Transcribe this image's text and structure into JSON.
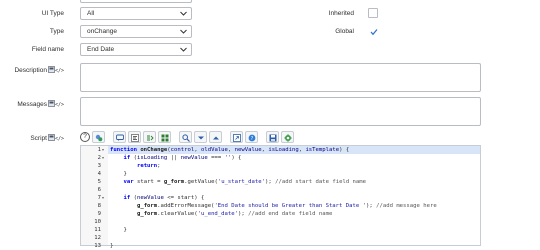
{
  "form": {
    "ui_type": {
      "label": "UI Type",
      "value": "All"
    },
    "type": {
      "label": "Type",
      "value": "onChange"
    },
    "field_name": {
      "label": "Field name",
      "value": "End Date"
    },
    "inherited": {
      "label": "Inherited",
      "checked": false
    },
    "global": {
      "label": "Global",
      "checked": true
    },
    "description": {
      "label": "Description",
      "tag": "</>",
      "value": ""
    },
    "messages": {
      "label": "Messages",
      "tag": "</>",
      "value": ""
    },
    "script": {
      "label": "Script",
      "tag": "</>"
    }
  },
  "toolbar": {
    "help": "?",
    "buttons": [
      "toggle-syntax-icon",
      "comment-icon",
      "format-icon",
      "replace-icon",
      "replace-all-icon",
      "search-icon",
      "next-icon",
      "previous-icon",
      "fullscreen-icon",
      "help-circle-icon",
      "save-icon",
      "script-debugger-icon"
    ]
  },
  "code": {
    "line_numbers": [
      "1",
      "2",
      "3",
      "4",
      "5",
      "6",
      "7",
      "8",
      "9",
      "10",
      "11",
      "12",
      "13"
    ],
    "fold_markers": [
      "▾",
      "▾",
      "",
      "",
      "",
      "",
      "▾",
      "",
      "",
      "",
      "",
      "",
      ""
    ]
  }
}
